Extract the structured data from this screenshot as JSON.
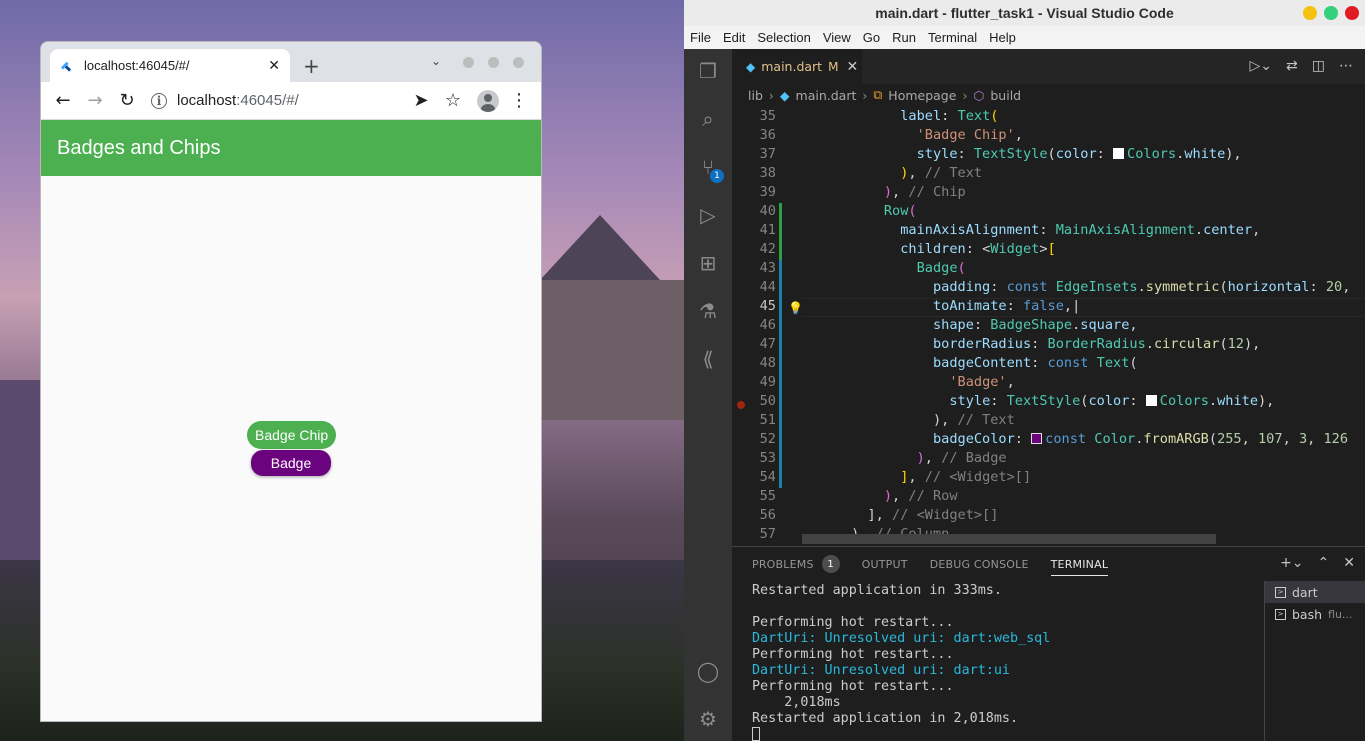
{
  "browser": {
    "tab_title": "localhost:46045/#/",
    "url_host": "localhost",
    "url_rest": ":46045/#/"
  },
  "app": {
    "appbar_title": "Badges and Chips",
    "chip_label": "Badge Chip",
    "badge_label": "Badge",
    "colors": {
      "appbar": "#4caf50",
      "chip": "#4caf50",
      "badge": "#6b037e"
    }
  },
  "vscode": {
    "window_title": "main.dart - flutter_task1 - Visual Studio Code",
    "menu": [
      "File",
      "Edit",
      "Selection",
      "View",
      "Go",
      "Run",
      "Terminal",
      "Help"
    ],
    "scm_badge": "1",
    "editor_tab": {
      "name": "main.dart",
      "status": "M"
    },
    "breadcrumbs": [
      "lib",
      "main.dart",
      "Homepage",
      "build"
    ],
    "code_lines": [
      {
        "n": "35",
        "text": "            label: Text("
      },
      {
        "n": "36",
        "text": "              'Badge Chip',"
      },
      {
        "n": "37",
        "text": "              style: TextStyle(color: Colors.white),"
      },
      {
        "n": "38",
        "text": "            ), // Text"
      },
      {
        "n": "39",
        "text": "          ), // Chip"
      },
      {
        "n": "40",
        "text": "          Row("
      },
      {
        "n": "41",
        "text": "            mainAxisAlignment: MainAxisAlignment.center,"
      },
      {
        "n": "42",
        "text": "            children: <Widget>["
      },
      {
        "n": "43",
        "text": "              Badge("
      },
      {
        "n": "44",
        "text": "                padding: const EdgeInsets.symmetric(horizontal: 20,"
      },
      {
        "n": "45",
        "text": "                toAnimate: false,"
      },
      {
        "n": "46",
        "text": "                shape: BadgeShape.square,"
      },
      {
        "n": "47",
        "text": "                borderRadius: BorderRadius.circular(12),"
      },
      {
        "n": "48",
        "text": "                badgeContent: const Text("
      },
      {
        "n": "49",
        "text": "                  'Badge',"
      },
      {
        "n": "50",
        "text": "                  style: TextStyle(color: Colors.white),"
      },
      {
        "n": "51",
        "text": "                ), // Text"
      },
      {
        "n": "52",
        "text": "                badgeColor: const Color.fromARGB(255, 107, 3, 126"
      },
      {
        "n": "53",
        "text": "              ), // Badge"
      },
      {
        "n": "54",
        "text": "            ], // <Widget>[]"
      },
      {
        "n": "55",
        "text": "          ), // Row"
      },
      {
        "n": "56",
        "text": "        ], // <Widget>[]"
      },
      {
        "n": "57",
        "text": "      ), // Column"
      }
    ],
    "panel_tabs": {
      "problems": "PROBLEMS",
      "problems_count": "1",
      "output": "OUTPUT",
      "debug": "DEBUG CONSOLE",
      "terminal": "TERMINAL"
    },
    "terminal_lines": [
      "Restarted application in 333ms.",
      "",
      "Performing hot restart...",
      "DartUri: Unresolved uri: dart:web_sql",
      "Performing hot restart...",
      "DartUri: Unresolved uri: dart:ui",
      "Performing hot restart...",
      "    2,018ms",
      "Restarted application in 2,018ms."
    ],
    "terminal_list": [
      {
        "name": "dart",
        "sub": ""
      },
      {
        "name": "bash",
        "sub": "flu..."
      }
    ]
  }
}
